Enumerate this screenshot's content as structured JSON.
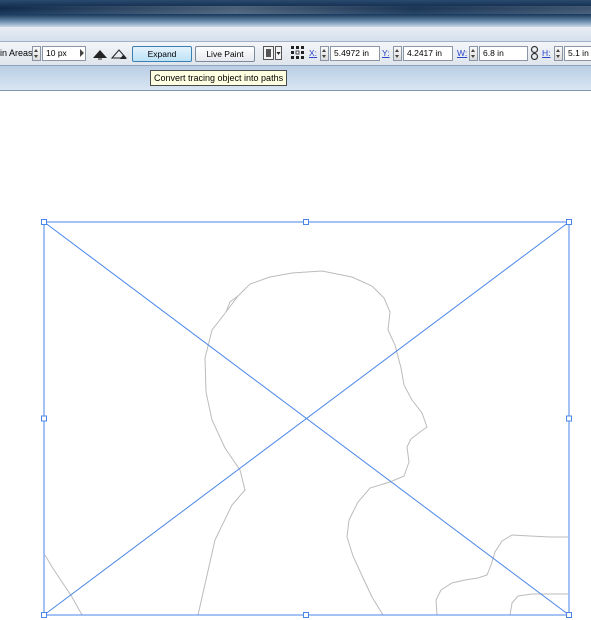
{
  "toolbar": {
    "areas_label": "in Areas:",
    "areas_value": "10 px",
    "expand_label": "Expand",
    "live_paint_label": "Live Paint",
    "x_label": "X:",
    "x_value": "5.4972 in",
    "y_label": "Y:",
    "y_value": "4.2417 in",
    "w_label": "W:",
    "w_value": "6.8 in",
    "h_label": "H:",
    "h_value": "5.1 in"
  },
  "tooltip": {
    "text": "Convert tracing object into paths"
  },
  "colors": {
    "selection": "#4a86e8",
    "tracing_outline": "#b8b8b8",
    "tooltip_bg": "#ffffe1"
  }
}
